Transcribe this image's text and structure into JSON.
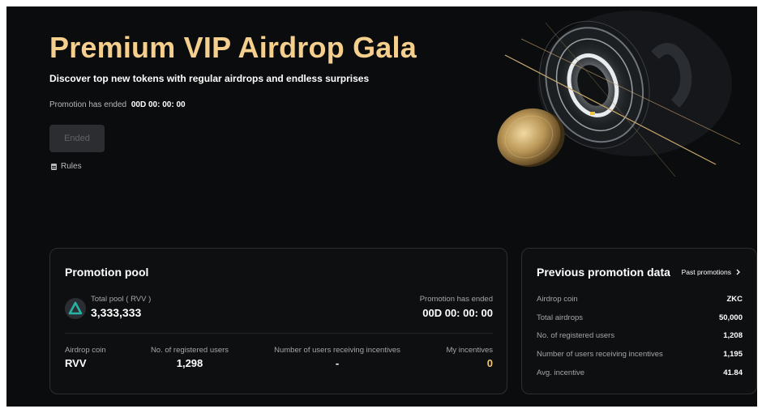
{
  "hero": {
    "title": "Premium VIP Airdrop Gala",
    "subtitle": "Discover top new tokens with regular airdrops and endless surprises",
    "countdown_label": "Promotion has ended",
    "countdown_value": "00D 00: 00: 00",
    "status_button": "Ended",
    "rules_link": "Rules"
  },
  "promotion_pool": {
    "title": "Promotion pool",
    "total_pool_label": "Total pool ( RVV )",
    "total_pool_value": "3,333,333",
    "ended_label": "Promotion has ended",
    "timer": "00D 00: 00: 00",
    "stats": [
      {
        "label": "Airdrop coin",
        "value": "RVV"
      },
      {
        "label": "No. of registered users",
        "value": "1,298"
      },
      {
        "label": "Number of users receiving incentives",
        "value": "-"
      },
      {
        "label": "My incentives",
        "value": "0"
      }
    ]
  },
  "previous": {
    "title": "Previous promotion data",
    "link": "Past promotions",
    "rows": [
      {
        "label": "Airdrop coin",
        "value": "ZKC"
      },
      {
        "label": "Total airdrops",
        "value": "50,000"
      },
      {
        "label": "No. of registered users",
        "value": "1,208"
      },
      {
        "label": "Number of users receiving incentives",
        "value": "1,195"
      },
      {
        "label": "Avg. incentive",
        "value": "41.84"
      }
    ]
  },
  "colors": {
    "accent_gold": "#f5cf8e",
    "background": "#0b0c0d",
    "token_logo": "#27b3a4"
  },
  "icons": [
    "document-icon",
    "chevron-right-icon",
    "token-logo-icon",
    "coin-illustration"
  ]
}
